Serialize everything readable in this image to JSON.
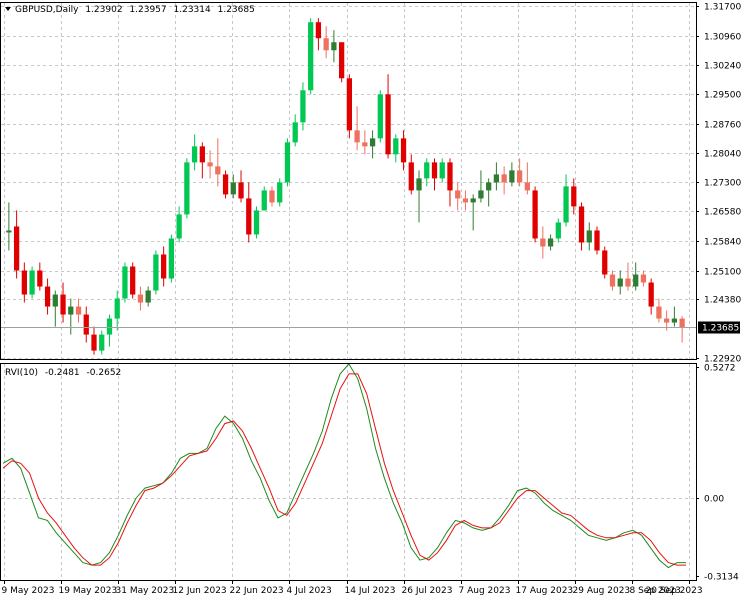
{
  "main_header": {
    "symbol_label": "GBPUSD,Daily",
    "open": "1.23902",
    "high": "1.23957",
    "low": "1.23314",
    "close": "1.23685"
  },
  "indicator_header": {
    "name": "RVI(10)",
    "main_value": "-0.2481",
    "signal_value": "-0.2652"
  },
  "current_price_label": "1.23685",
  "colors": {
    "bull": "#2e7d32",
    "bull_light": "#00c853",
    "bear": "#e00000",
    "bear_light": "#f07060",
    "rvi_main": "#1e8a1e",
    "rvi_signal": "#e81010",
    "grid": "#c8c8c8",
    "price_label_bg": "#000000"
  },
  "chart_data": [
    {
      "type": "candlestick",
      "title": "GBPUSD,Daily",
      "yticks": [
        "1.31700",
        "1.30960",
        "1.30240",
        "1.29500",
        "1.28760",
        "1.28040",
        "1.27300",
        "1.26580",
        "1.25840",
        "1.25100",
        "1.24380",
        "1.23685",
        "1.22920"
      ],
      "ylim": [
        1.2289,
        1.3178
      ],
      "xticks": [
        "9 May 2023",
        "19 May 2023",
        "31 May 2023",
        "12 Jun 2023",
        "22 Jun 2023",
        "4 Jul 2023",
        "14 Jul 2023",
        "26 Jul 2023",
        "7 Aug 2023",
        "17 Aug 2023",
        "29 Aug 2023",
        "8 Sep 2023",
        "20 Sep 2023"
      ],
      "grid": true,
      "candles": [
        {
          "o": 1.2605,
          "h": 1.268,
          "l": 1.256,
          "c": 1.261
        },
        {
          "o": 1.262,
          "h": 1.266,
          "l": 1.249,
          "c": 1.251
        },
        {
          "o": 1.251,
          "h": 1.253,
          "l": 1.243,
          "c": 1.245
        },
        {
          "o": 1.245,
          "h": 1.252,
          "l": 1.244,
          "c": 1.251
        },
        {
          "o": 1.251,
          "h": 1.253,
          "l": 1.246,
          "c": 1.247
        },
        {
          "o": 1.247,
          "h": 1.249,
          "l": 1.24,
          "c": 1.242
        },
        {
          "o": 1.242,
          "h": 1.246,
          "l": 1.237,
          "c": 1.245
        },
        {
          "o": 1.245,
          "h": 1.248,
          "l": 1.238,
          "c": 1.24
        },
        {
          "o": 1.24,
          "h": 1.244,
          "l": 1.235,
          "c": 1.242
        },
        {
          "o": 1.242,
          "h": 1.244,
          "l": 1.238,
          "c": 1.24
        },
        {
          "o": 1.24,
          "h": 1.242,
          "l": 1.233,
          "c": 1.235
        },
        {
          "o": 1.235,
          "h": 1.237,
          "l": 1.23,
          "c": 1.231
        },
        {
          "o": 1.231,
          "h": 1.236,
          "l": 1.23,
          "c": 1.235
        },
        {
          "o": 1.235,
          "h": 1.24,
          "l": 1.232,
          "c": 1.239
        },
        {
          "o": 1.239,
          "h": 1.246,
          "l": 1.236,
          "c": 1.244
        },
        {
          "o": 1.244,
          "h": 1.253,
          "l": 1.243,
          "c": 1.252
        },
        {
          "o": 1.252,
          "h": 1.253,
          "l": 1.244,
          "c": 1.245
        },
        {
          "o": 1.245,
          "h": 1.247,
          "l": 1.241,
          "c": 1.243
        },
        {
          "o": 1.243,
          "h": 1.247,
          "l": 1.242,
          "c": 1.246
        },
        {
          "o": 1.246,
          "h": 1.256,
          "l": 1.245,
          "c": 1.255
        },
        {
          "o": 1.255,
          "h": 1.257,
          "l": 1.247,
          "c": 1.249
        },
        {
          "o": 1.249,
          "h": 1.26,
          "l": 1.248,
          "c": 1.259
        },
        {
          "o": 1.259,
          "h": 1.267,
          "l": 1.258,
          "c": 1.265
        },
        {
          "o": 1.265,
          "h": 1.279,
          "l": 1.264,
          "c": 1.278
        },
        {
          "o": 1.278,
          "h": 1.285,
          "l": 1.276,
          "c": 1.282
        },
        {
          "o": 1.282,
          "h": 1.283,
          "l": 1.274,
          "c": 1.278
        },
        {
          "o": 1.278,
          "h": 1.281,
          "l": 1.274,
          "c": 1.277
        },
        {
          "o": 1.277,
          "h": 1.284,
          "l": 1.272,
          "c": 1.275
        },
        {
          "o": 1.275,
          "h": 1.276,
          "l": 1.269,
          "c": 1.27
        },
        {
          "o": 1.27,
          "h": 1.275,
          "l": 1.269,
          "c": 1.273
        },
        {
          "o": 1.273,
          "h": 1.276,
          "l": 1.268,
          "c": 1.269
        },
        {
          "o": 1.269,
          "h": 1.273,
          "l": 1.258,
          "c": 1.26
        },
        {
          "o": 1.26,
          "h": 1.267,
          "l": 1.259,
          "c": 1.266
        },
        {
          "o": 1.266,
          "h": 1.272,
          "l": 1.266,
          "c": 1.271
        },
        {
          "o": 1.271,
          "h": 1.272,
          "l": 1.267,
          "c": 1.268
        },
        {
          "o": 1.268,
          "h": 1.274,
          "l": 1.267,
          "c": 1.273
        },
        {
          "o": 1.273,
          "h": 1.284,
          "l": 1.272,
          "c": 1.283
        },
        {
          "o": 1.283,
          "h": 1.29,
          "l": 1.282,
          "c": 1.288
        },
        {
          "o": 1.288,
          "h": 1.298,
          "l": 1.286,
          "c": 1.296
        },
        {
          "o": 1.296,
          "h": 1.314,
          "l": 1.295,
          "c": 1.313
        },
        {
          "o": 1.313,
          "h": 1.314,
          "l": 1.306,
          "c": 1.309
        },
        {
          "o": 1.309,
          "h": 1.312,
          "l": 1.304,
          "c": 1.306
        },
        {
          "o": 1.306,
          "h": 1.311,
          "l": 1.303,
          "c": 1.308
        },
        {
          "o": 1.308,
          "h": 1.308,
          "l": 1.298,
          "c": 1.299
        },
        {
          "o": 1.299,
          "h": 1.3,
          "l": 1.284,
          "c": 1.286
        },
        {
          "o": 1.286,
          "h": 1.292,
          "l": 1.281,
          "c": 1.283
        },
        {
          "o": 1.283,
          "h": 1.286,
          "l": 1.28,
          "c": 1.282
        },
        {
          "o": 1.282,
          "h": 1.286,
          "l": 1.279,
          "c": 1.284
        },
        {
          "o": 1.284,
          "h": 1.296,
          "l": 1.283,
          "c": 1.295
        },
        {
          "o": 1.295,
          "h": 1.3,
          "l": 1.279,
          "c": 1.28
        },
        {
          "o": 1.28,
          "h": 1.285,
          "l": 1.278,
          "c": 1.284
        },
        {
          "o": 1.284,
          "h": 1.286,
          "l": 1.276,
          "c": 1.278
        },
        {
          "o": 1.278,
          "h": 1.28,
          "l": 1.27,
          "c": 1.271
        },
        {
          "o": 1.271,
          "h": 1.276,
          "l": 1.263,
          "c": 1.274
        },
        {
          "o": 1.274,
          "h": 1.279,
          "l": 1.272,
          "c": 1.278
        },
        {
          "o": 1.278,
          "h": 1.279,
          "l": 1.271,
          "c": 1.274
        },
        {
          "o": 1.274,
          "h": 1.279,
          "l": 1.273,
          "c": 1.278
        },
        {
          "o": 1.278,
          "h": 1.279,
          "l": 1.267,
          "c": 1.271
        },
        {
          "o": 1.271,
          "h": 1.273,
          "l": 1.266,
          "c": 1.269
        },
        {
          "o": 1.269,
          "h": 1.271,
          "l": 1.266,
          "c": 1.268
        },
        {
          "o": 1.268,
          "h": 1.27,
          "l": 1.261,
          "c": 1.269
        },
        {
          "o": 1.269,
          "h": 1.276,
          "l": 1.268,
          "c": 1.271
        },
        {
          "o": 1.271,
          "h": 1.274,
          "l": 1.267,
          "c": 1.273
        },
        {
          "o": 1.273,
          "h": 1.278,
          "l": 1.271,
          "c": 1.275
        },
        {
          "o": 1.275,
          "h": 1.277,
          "l": 1.27,
          "c": 1.273
        },
        {
          "o": 1.273,
          "h": 1.278,
          "l": 1.272,
          "c": 1.276
        },
        {
          "o": 1.276,
          "h": 1.279,
          "l": 1.272,
          "c": 1.273
        },
        {
          "o": 1.273,
          "h": 1.278,
          "l": 1.27,
          "c": 1.271
        },
        {
          "o": 1.271,
          "h": 1.272,
          "l": 1.258,
          "c": 1.259
        },
        {
          "o": 1.259,
          "h": 1.262,
          "l": 1.254,
          "c": 1.257
        },
        {
          "o": 1.257,
          "h": 1.26,
          "l": 1.256,
          "c": 1.259
        },
        {
          "o": 1.259,
          "h": 1.264,
          "l": 1.258,
          "c": 1.263
        },
        {
          "o": 1.263,
          "h": 1.275,
          "l": 1.262,
          "c": 1.272
        },
        {
          "o": 1.272,
          "h": 1.274,
          "l": 1.265,
          "c": 1.267
        },
        {
          "o": 1.267,
          "h": 1.268,
          "l": 1.256,
          "c": 1.258
        },
        {
          "o": 1.258,
          "h": 1.263,
          "l": 1.256,
          "c": 1.261
        },
        {
          "o": 1.261,
          "h": 1.262,
          "l": 1.255,
          "c": 1.256
        },
        {
          "o": 1.256,
          "h": 1.257,
          "l": 1.249,
          "c": 1.25
        },
        {
          "o": 1.25,
          "h": 1.251,
          "l": 1.246,
          "c": 1.247
        },
        {
          "o": 1.247,
          "h": 1.251,
          "l": 1.245,
          "c": 1.249
        },
        {
          "o": 1.249,
          "h": 1.253,
          "l": 1.246,
          "c": 1.247
        },
        {
          "o": 1.247,
          "h": 1.253,
          "l": 1.246,
          "c": 1.25
        },
        {
          "o": 1.25,
          "h": 1.251,
          "l": 1.247,
          "c": 1.248
        },
        {
          "o": 1.248,
          "h": 1.249,
          "l": 1.24,
          "c": 1.242
        },
        {
          "o": 1.242,
          "h": 1.244,
          "l": 1.238,
          "c": 1.239
        },
        {
          "o": 1.239,
          "h": 1.241,
          "l": 1.236,
          "c": 1.238
        },
        {
          "o": 1.238,
          "h": 1.242,
          "l": 1.237,
          "c": 1.239
        },
        {
          "o": 1.239,
          "h": 1.2396,
          "l": 1.233,
          "c": 1.2369
        }
      ]
    },
    {
      "type": "line",
      "title": "RVI(10)",
      "yticks": [
        "0.5272",
        "0.00",
        "-0.3134"
      ],
      "ylim": [
        -0.33,
        0.54
      ],
      "grid": true,
      "series": [
        {
          "values": [
            0.14,
            0.16,
            0.12,
            0.02,
            -0.08,
            -0.09,
            -0.14,
            -0.18,
            -0.22,
            -0.26,
            -0.27,
            -0.26,
            -0.22,
            -0.15,
            -0.07,
            0.0,
            0.04,
            0.05,
            0.06,
            0.1,
            0.16,
            0.18,
            0.18,
            0.2,
            0.28,
            0.33,
            0.3,
            0.24,
            0.15,
            0.08,
            -0.01,
            -0.08,
            -0.06,
            0.02,
            0.1,
            0.18,
            0.27,
            0.4,
            0.5,
            0.54,
            0.48,
            0.36,
            0.2,
            0.08,
            -0.02,
            -0.1,
            -0.2,
            -0.25,
            -0.24,
            -0.2,
            -0.14,
            -0.09,
            -0.1,
            -0.12,
            -0.13,
            -0.12,
            -0.08,
            -0.03,
            0.03,
            0.04,
            0.02,
            -0.02,
            -0.05,
            -0.07,
            -0.09,
            -0.12,
            -0.15,
            -0.16,
            -0.17,
            -0.16,
            -0.14,
            -0.13,
            -0.15,
            -0.2,
            -0.25,
            -0.28,
            -0.26,
            -0.26
          ]
        },
        {
          "values": [
            0.12,
            0.15,
            0.14,
            0.1,
            0.0,
            -0.06,
            -0.1,
            -0.15,
            -0.2,
            -0.24,
            -0.27,
            -0.27,
            -0.24,
            -0.18,
            -0.1,
            -0.03,
            0.03,
            0.04,
            0.06,
            0.09,
            0.13,
            0.17,
            0.18,
            0.19,
            0.24,
            0.3,
            0.31,
            0.27,
            0.2,
            0.12,
            0.04,
            -0.05,
            -0.07,
            -0.02,
            0.06,
            0.14,
            0.22,
            0.33,
            0.44,
            0.5,
            0.5,
            0.42,
            0.28,
            0.14,
            0.03,
            -0.06,
            -0.15,
            -0.23,
            -0.25,
            -0.22,
            -0.17,
            -0.11,
            -0.09,
            -0.11,
            -0.12,
            -0.12,
            -0.1,
            -0.05,
            0.0,
            0.03,
            0.03,
            0.0,
            -0.03,
            -0.06,
            -0.07,
            -0.1,
            -0.13,
            -0.15,
            -0.16,
            -0.16,
            -0.15,
            -0.14,
            -0.14,
            -0.17,
            -0.22,
            -0.26,
            -0.27,
            -0.27
          ]
        }
      ]
    }
  ]
}
